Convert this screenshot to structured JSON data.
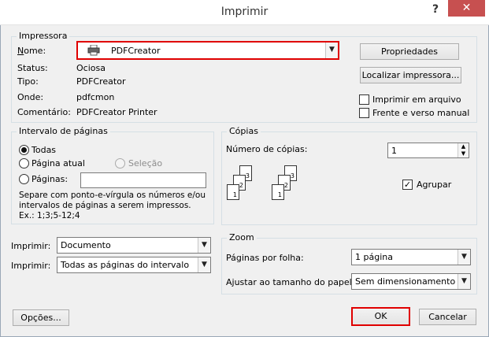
{
  "window": {
    "title": "Imprimir",
    "help": "?",
    "close": "✕"
  },
  "printer": {
    "group_label": "Impressora",
    "name_label": "Nome:",
    "name_value": "PDFCreator",
    "status_label": "Status:",
    "status_value": "Ociosa",
    "type_label": "Tipo:",
    "type_value": "PDFCreator",
    "where_label": "Onde:",
    "where_value": "pdfcmon",
    "comment_label": "Comentário:",
    "comment_value": "PDFCreator Printer",
    "properties_button": "Propriedades",
    "find_printer_button": "Localizar impressora...",
    "print_to_file_label": "Imprimir em arquivo",
    "duplex_label": "Frente e verso manual"
  },
  "page_range": {
    "group_label": "Intervalo de páginas",
    "all_label": "Todas",
    "current_page_label": "Página atual",
    "selection_label": "Seleção",
    "pages_label": "Páginas:",
    "pages_value": "",
    "help_text": "Separe com ponto-e-vírgula os números e/ou intervalos de páginas a serem impressos.  Ex.: 1;3;5-12;4"
  },
  "print_what": {
    "label1": "Imprimir:",
    "value1": "Documento",
    "label2": "Imprimir:",
    "value2": "Todas as páginas do intervalo"
  },
  "copies": {
    "group_label": "Cópias",
    "count_label": "Número de cópias:",
    "count_value": "1",
    "collate_label": "Agrupar",
    "page_numbers": [
      "1",
      "2",
      "3"
    ]
  },
  "zoom": {
    "group_label": "Zoom",
    "pages_per_sheet_label": "Páginas por folha:",
    "pages_per_sheet_value": "1 página",
    "scale_label": "Ajustar ao tamanho do papel:",
    "scale_value": "Sem dimensionamento"
  },
  "footer": {
    "options_button": "Opções...",
    "ok_button": "OK",
    "cancel_button": "Cancelar"
  },
  "colors": {
    "highlight": "#e00000",
    "close_button": "#c75050"
  }
}
